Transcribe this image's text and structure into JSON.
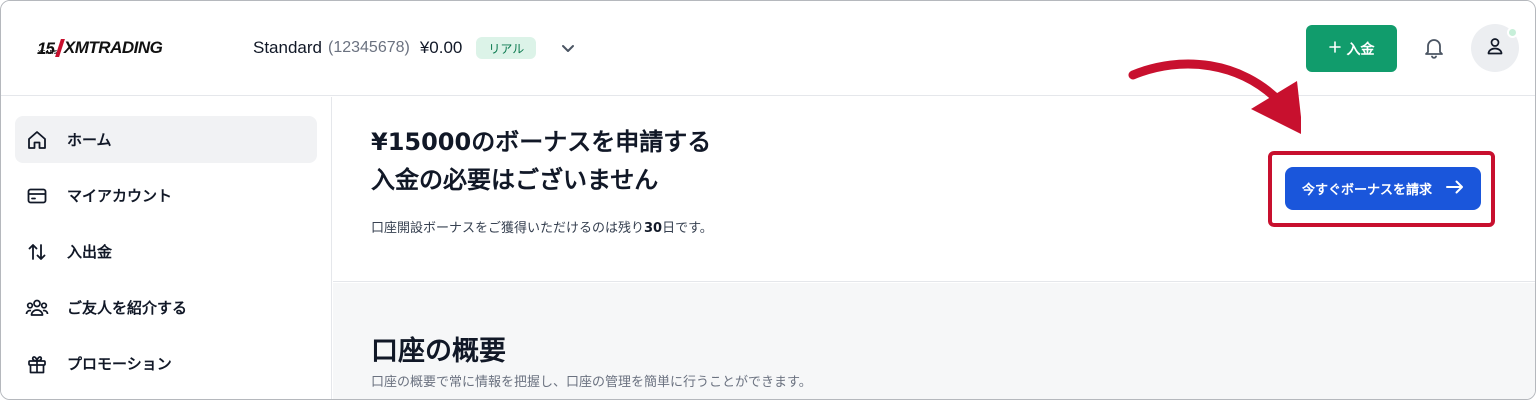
{
  "header": {
    "logo_number": "15",
    "logo_years": "YEARS",
    "logo_text": "XMTRADING",
    "account_name": "Standard",
    "account_number": "(12345678)",
    "balance": "¥0.00",
    "badge": "リアル",
    "deposit_label": "入金"
  },
  "sidebar": {
    "items": [
      {
        "label": "ホーム",
        "icon": "home-icon"
      },
      {
        "label": "マイアカウント",
        "icon": "card-icon"
      },
      {
        "label": "入出金",
        "icon": "transfer-arrows-icon"
      },
      {
        "label": "ご友人を紹介する",
        "icon": "users-icon"
      },
      {
        "label": "プロモーション",
        "icon": "gift-icon"
      }
    ]
  },
  "banner": {
    "title_line1": "¥15000のボーナスを申請する",
    "title_line2": "入金の必要はございません",
    "sub_prefix": "口座開設ボーナスをご獲得いただけるのは残り",
    "sub_days": "30",
    "sub_suffix": "日です。",
    "claim_label": "今すぐボーナスを請求"
  },
  "overview": {
    "title": "口座の概要",
    "subtitle": "口座の概要で常に情報を把握し、口座の管理を簡単に行うことができます。"
  },
  "colors": {
    "deposit": "#119c6c",
    "claim": "#1a56db",
    "highlight": "#c8102e",
    "badge_bg": "#dcf3e8"
  }
}
